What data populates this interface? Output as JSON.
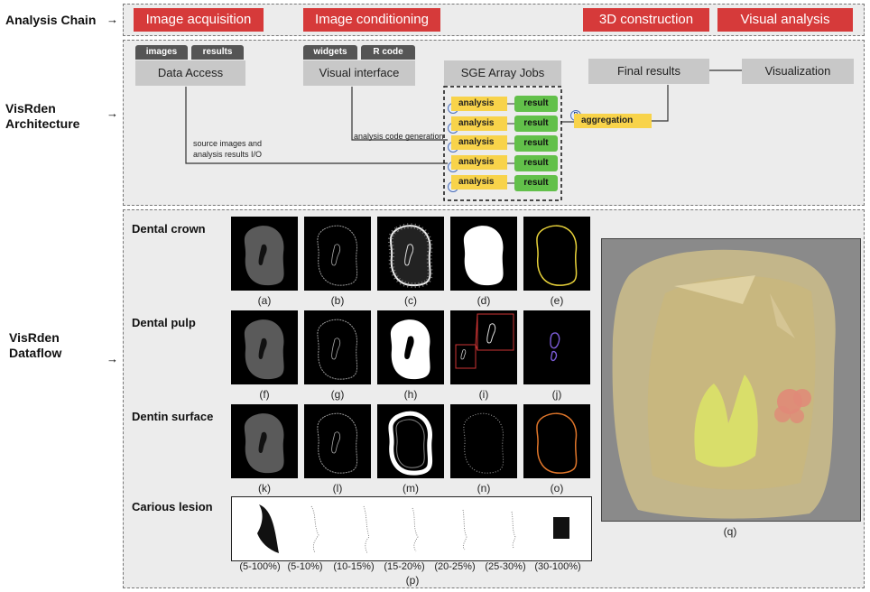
{
  "labels": {
    "analysis_chain": "Analysis Chain",
    "architecture_1": "VisRden",
    "architecture_2": "Architecture",
    "dataflow_1": "VisRden",
    "dataflow_2": "Dataflow"
  },
  "chain": {
    "steps": [
      "Image acquisition",
      "Image conditioning",
      "3D construction",
      "Visual analysis"
    ]
  },
  "architecture": {
    "data_access": {
      "tabs": [
        "images",
        "results"
      ],
      "label": "Data Access"
    },
    "visual_interface": {
      "tabs": [
        "widgets",
        "R code"
      ],
      "label": "Visual interface"
    },
    "sge_jobs": "SGE Array Jobs",
    "final_results": "Final results",
    "visualization": "Visualization",
    "jobs": [
      {
        "analysis": "analysis",
        "result": "result"
      },
      {
        "analysis": "analysis",
        "result": "result"
      },
      {
        "analysis": "analysis",
        "result": "result"
      },
      {
        "analysis": "analysis",
        "result": "result"
      },
      {
        "analysis": "analysis",
        "result": "result"
      }
    ],
    "r_badge": "R",
    "aggregation": "aggregation",
    "code_gen_label": "analysis code generation",
    "io_label_1": "source images and",
    "io_label_2": "analysis results I/O"
  },
  "dataflow": {
    "rows": [
      {
        "label": "Dental crown",
        "captions": [
          "(a)",
          "(b)",
          "(c)",
          "(d)",
          "(e)"
        ]
      },
      {
        "label": "Dental pulp",
        "captions": [
          "(f)",
          "(g)",
          "(h)",
          "(i)",
          "(j)"
        ]
      },
      {
        "label": "Dentin surface",
        "captions": [
          "(k)",
          "(l)",
          "(m)",
          "(n)",
          "(o)"
        ]
      }
    ],
    "carious": {
      "label": "Carious lesion",
      "ranges": [
        "(5-100%)",
        "(5-10%)",
        "(10-15%)",
        "(15-20%)",
        "(20-25%)",
        "(25-30%)",
        "(30-100%)"
      ],
      "caption": "(p)"
    },
    "model_caption": "(q)"
  },
  "colors": {
    "chain_red": "#d63a3a",
    "yellow": "#f8d34a",
    "green": "#62c04a",
    "outline_yellow": "#e8d23a",
    "outline_purple": "#7b5bd6",
    "outline_orange": "#e0762a"
  }
}
